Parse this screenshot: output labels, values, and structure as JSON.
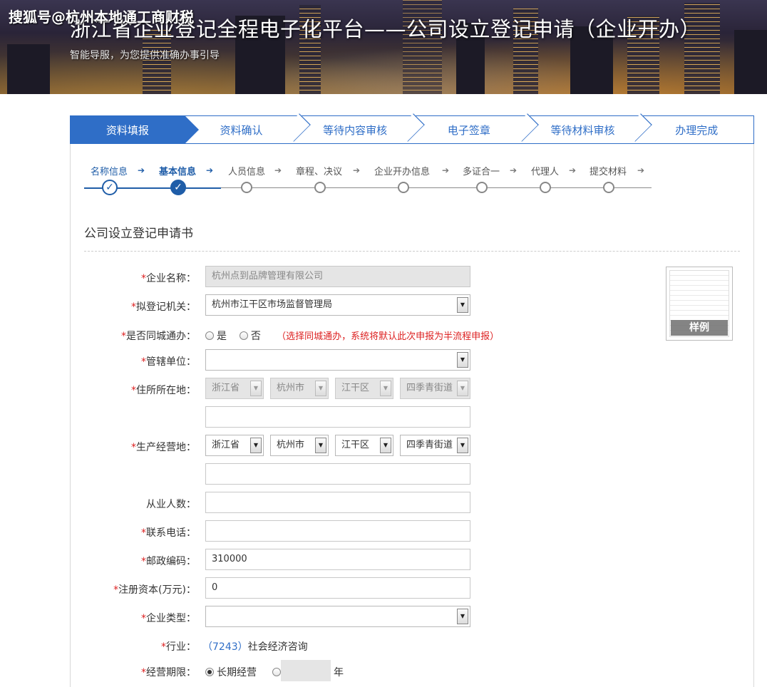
{
  "banner": {
    "watermark": "搜狐号@杭州本地通工商财税",
    "title": "浙江省企业登记全程电子化平台——公司设立登记申请（企业开办）",
    "subtitle": "智能导服，为您提供准确办事引导"
  },
  "steps": [
    "资料填报",
    "资料确认",
    "等待内容审核",
    "电子签章",
    "等待材料审核",
    "办理完成"
  ],
  "substeps": [
    "名称信息",
    "基本信息",
    "人员信息",
    "章程、决议",
    "企业开办信息",
    "多证合一",
    "代理人",
    "提交材料"
  ],
  "form": {
    "title": "公司设立登记申请书",
    "required_mark": "*",
    "company_name_label": "企业名称：",
    "company_name_value": "杭州点到品牌管理有限公司",
    "registry_label": "拟登记机关：",
    "registry_value": "杭州市江干区市场监督管理局",
    "same_city_label": "是否同城通办：",
    "same_city_yes": "是",
    "same_city_no": "否",
    "same_city_note": "（选择同城通办，系统将默认此次申报为半流程申报）",
    "jurisdiction_label": "管辖单位：",
    "jurisdiction_value": "",
    "residence_label": "住所所在地：",
    "residence_province": "浙江省",
    "residence_city": "杭州市",
    "residence_district": "江干区",
    "residence_street": "四季青街道",
    "residence_detail": "",
    "business_label": "生产经营地：",
    "business_province": "浙江省",
    "business_city": "杭州市",
    "business_district": "江干区",
    "business_street": "四季青街道",
    "business_detail": "",
    "employees_label": "从业人数：",
    "employees_value": "",
    "phone_label": "联系电话：",
    "phone_value": "",
    "postcode_label": "邮政编码：",
    "postcode_value": "310000",
    "capital_label": "注册资本(万元)：",
    "capital_value": "0",
    "type_label": "企业类型：",
    "type_value": "",
    "industry_label": "行业：",
    "industry_code": "（7243）",
    "industry_name": "社会经济咨询",
    "term_label": "经营期限：",
    "term_long": "长期经营",
    "term_years_value": "",
    "term_unit": "年"
  },
  "sample_label": "样例",
  "colors": {
    "accent": "#2f6ec7",
    "required": "#dd2222",
    "node_active": "#1f5da8"
  },
  "icons": {
    "dropdown": "chevron-down-icon",
    "check": "check-icon",
    "arrow": "arrow-right-icon"
  }
}
